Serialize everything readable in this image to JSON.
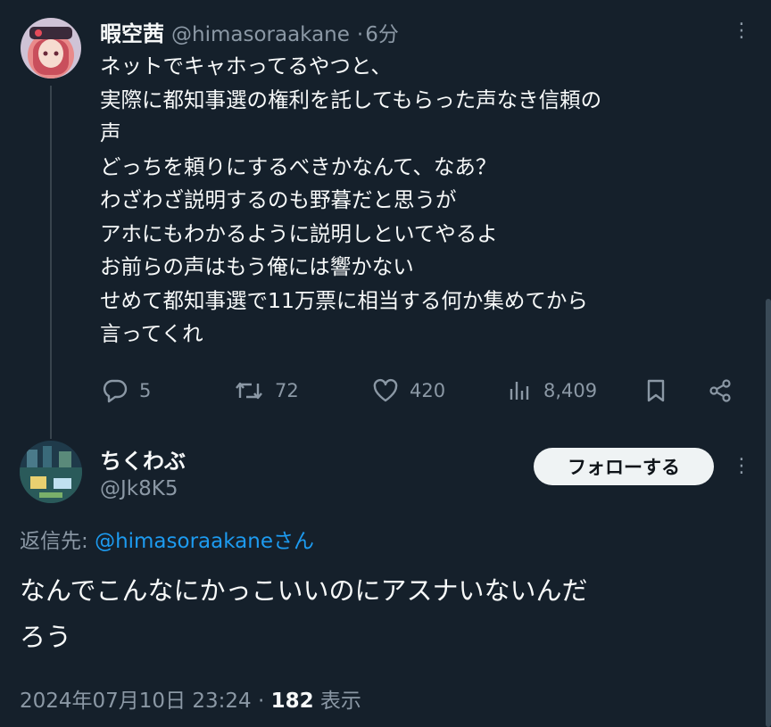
{
  "tweet1": {
    "display_name": "暇空茜",
    "handle": "@himasoraakane",
    "separator": "·",
    "time": "6分",
    "text": "ネットでキャホってるやつと、\n実際に都知事選の権利を託してもらった声なき信頼の\n声\nどっちを頼りにするべきかなんて、なあ？\nわざわざ説明するのも野暮だと思うが\nアホにもわかるように説明しといてやるよ\nお前らの声はもう俺には響かない\nせめて都知事選で11万票に相当する何か集めてから\n言ってくれ",
    "replies": "5",
    "reposts": "72",
    "likes": "420",
    "views": "8,409",
    "more_icon": "⋮"
  },
  "tweet2": {
    "display_name": "ちくわぶ",
    "handle": "@Jk8K5",
    "follow_label": "フォローする",
    "more_icon": "⋮",
    "reply_prefix": "返信先: ",
    "reply_mention": "@himasoraakaneさん",
    "text": "なんでこんなにかっこいいのにアスナいないんだ\nろう",
    "datetime": "2024年07月10日 23:24",
    "separator": " · ",
    "views_count": "182",
    "views_label": " 表示"
  },
  "colors": {
    "background": "#15202b",
    "text": "#f7f9f9",
    "muted": "#8b98a5",
    "link": "#1d9bf0",
    "button_bg": "#eff3f4"
  }
}
